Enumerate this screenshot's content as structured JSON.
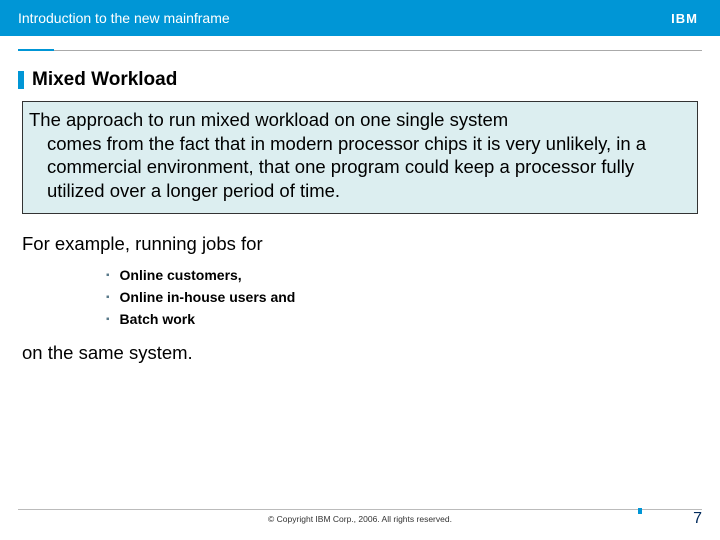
{
  "header": {
    "title": "Introduction to the new mainframe",
    "logo_alt": "IBM"
  },
  "slide": {
    "heading": "Mixed Workload",
    "boxed_paragraph_first": "The approach to run mixed workload on one single system",
    "boxed_paragraph_rest": "comes from the fact that in modern processor chips it is very unlikely, in a commercial environment, that one program could keep a processor fully utilized over a longer period of time.",
    "example_lead": "For example, running jobs for",
    "bullets": [
      "Online customers,",
      "Online in-house users  and",
      "Batch work"
    ],
    "closing": "on the same system."
  },
  "footer": {
    "copyright": "© Copyright IBM Corp., 2006. All rights reserved.",
    "page": "7"
  }
}
